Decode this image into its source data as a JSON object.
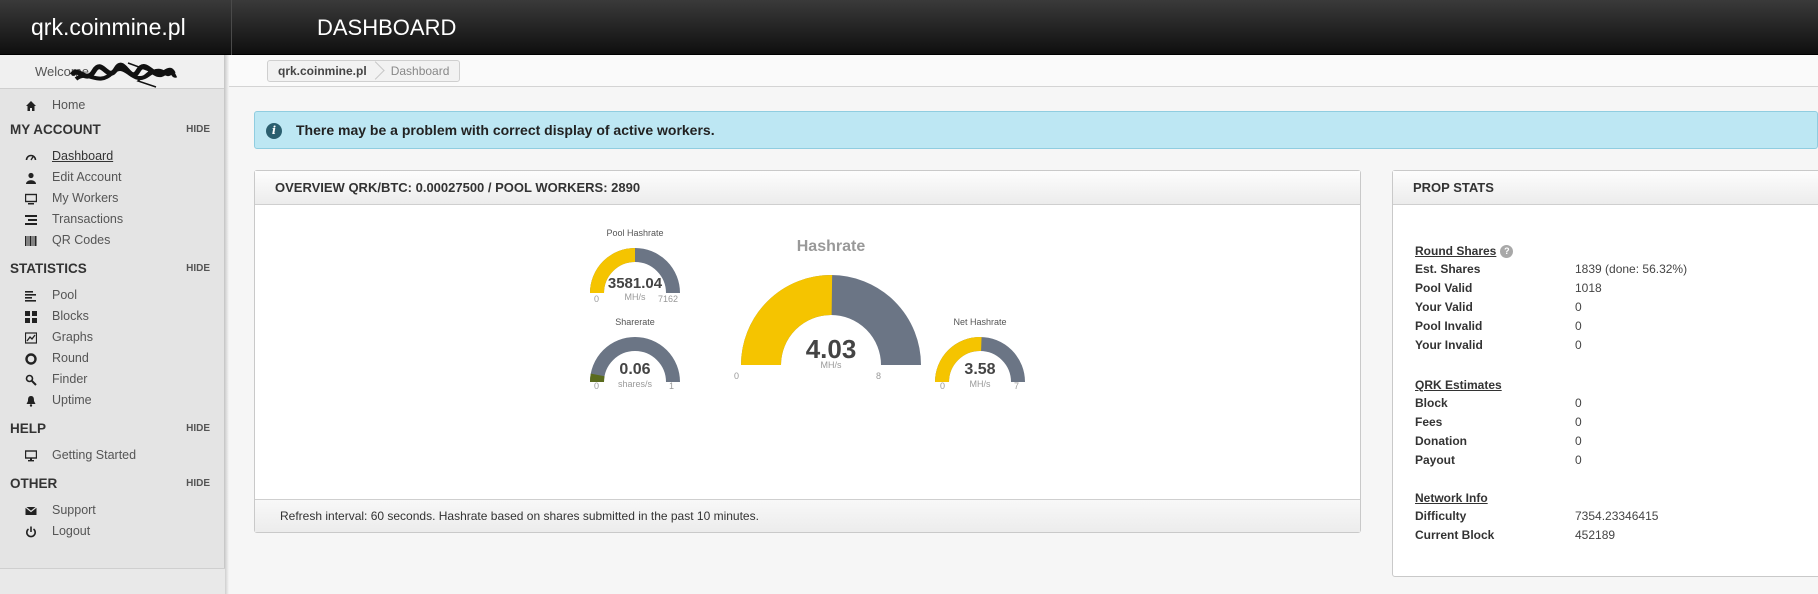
{
  "header": {
    "brand": "qrk.coinmine.pl",
    "page_title": "DASHBOARD"
  },
  "sidebar": {
    "welcome": "Welcome",
    "home": "Home",
    "sections": [
      {
        "title": "MY ACCOUNT",
        "hide": "HIDE",
        "items": [
          {
            "label": "Dashboard",
            "icon": "dashboard-icon"
          },
          {
            "label": "Edit Account",
            "icon": "user-icon"
          },
          {
            "label": "My Workers",
            "icon": "monitor-icon"
          },
          {
            "label": "Transactions",
            "icon": "list-icon"
          },
          {
            "label": "QR Codes",
            "icon": "barcode-icon"
          }
        ]
      },
      {
        "title": "STATISTICS",
        "hide": "HIDE",
        "items": [
          {
            "label": "Pool",
            "icon": "align-left-icon"
          },
          {
            "label": "Blocks",
            "icon": "grid-icon"
          },
          {
            "label": "Graphs",
            "icon": "chart-icon"
          },
          {
            "label": "Round",
            "icon": "circle-icon"
          },
          {
            "label": "Finder",
            "icon": "search-icon"
          },
          {
            "label": "Uptime",
            "icon": "bell-icon"
          }
        ]
      },
      {
        "title": "HELP",
        "hide": "HIDE",
        "items": [
          {
            "label": "Getting Started",
            "icon": "desktop-icon"
          }
        ]
      },
      {
        "title": "OTHER",
        "hide": "HIDE",
        "items": [
          {
            "label": "Support",
            "icon": "envelope-icon"
          },
          {
            "label": "Logout",
            "icon": "power-icon"
          }
        ]
      }
    ]
  },
  "breadcrumb": {
    "home": "qrk.coinmine.pl",
    "current": "Dashboard"
  },
  "alert": {
    "icon": "i",
    "text": "There may be a problem with correct display of active workers."
  },
  "overview": {
    "title": "OVERVIEW QRK/BTC: 0.00027500 / POOL WORKERS: 2890",
    "footer": "Refresh interval: 60 seconds. Hashrate based on shares submitted in the past 10 minutes.",
    "gauges": {
      "pool": {
        "title": "Pool Hashrate",
        "value": "3581.04",
        "unit": "MH/s",
        "min": "0",
        "max": "7162",
        "fraction": 0.5
      },
      "share": {
        "title": "Sharerate",
        "value": "0.06",
        "unit": "shares/s",
        "min": "0",
        "max": "1",
        "fraction": 0.06
      },
      "main": {
        "title": "Hashrate",
        "value": "4.03",
        "unit": "MH/s",
        "min": "0",
        "max": "8",
        "fraction": 0.504
      },
      "net": {
        "title": "Net Hashrate",
        "value": "3.58",
        "unit": "MH/s",
        "min": "0",
        "max": "7",
        "fraction": 0.511
      }
    },
    "colors": {
      "fill": "#f5c400",
      "track": "#6b7585",
      "low": "#5a6b1e"
    }
  },
  "prop": {
    "title": "PROP STATS",
    "round_shares": {
      "heading": "Round Shares",
      "help_icon": "?",
      "rows": [
        {
          "k": "Est. Shares",
          "v": "1839 (done: 56.32%)"
        },
        {
          "k": "Pool Valid",
          "v": "1018"
        },
        {
          "k": "Your Valid",
          "v": "0"
        },
        {
          "k": "Pool Invalid",
          "v": "0"
        },
        {
          "k": "Your Invalid",
          "v": "0"
        }
      ]
    },
    "estimates": {
      "heading": "QRK Estimates",
      "rows": [
        {
          "k": "Block",
          "v": "0"
        },
        {
          "k": "Fees",
          "v": "0"
        },
        {
          "k": "Donation",
          "v": "0"
        },
        {
          "k": "Payout",
          "v": "0"
        }
      ]
    },
    "network": {
      "heading": "Network Info",
      "rows": [
        {
          "k": "Difficulty",
          "v": "7354.23346415"
        },
        {
          "k": "Current Block",
          "v": "452189"
        }
      ]
    }
  }
}
